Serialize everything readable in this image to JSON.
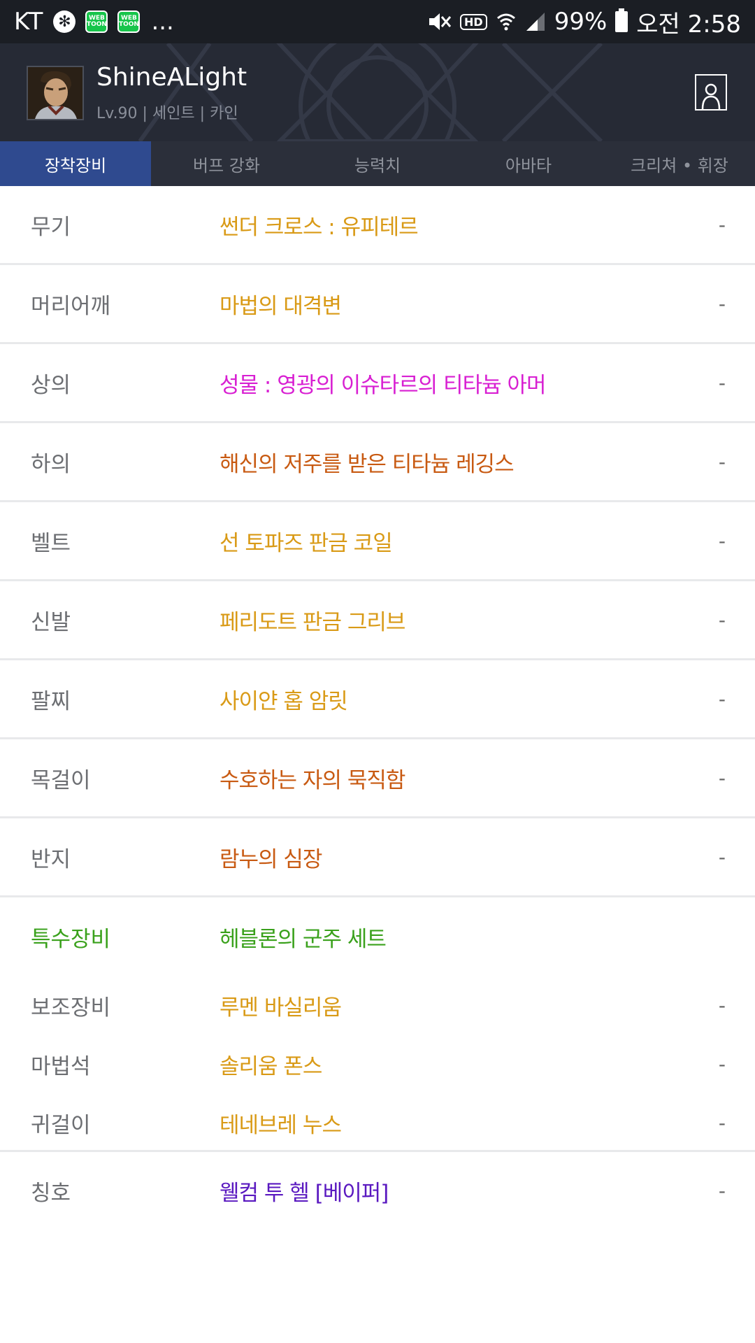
{
  "status_bar": {
    "carrier": "KT",
    "more": "...",
    "battery": "99%",
    "time": "오전 2:58",
    "hd": "HD",
    "webtoon_label": "WEB TOON",
    "icons": [
      "gear-icon",
      "webtoon-icon",
      "webtoon-icon",
      "mute-icon",
      "hd-icon",
      "wifi-icon",
      "signal-icon",
      "battery-icon"
    ]
  },
  "header": {
    "name": "ShineALight",
    "meta": "Lv.90 | 세인트 | 카인"
  },
  "tabs": [
    {
      "label": "장착장비",
      "active": true
    },
    {
      "label": "버프 강화",
      "active": false
    },
    {
      "label": "능력치",
      "active": false
    },
    {
      "label": "아바타",
      "active": false
    },
    {
      "label": "크리쳐 • 휘장",
      "active": false
    }
  ],
  "equipment": [
    {
      "slot": "무기",
      "item": "썬더 크로스 : 유피테르",
      "color": "#d99a16",
      "value": "-"
    },
    {
      "slot": "머리어깨",
      "item": "마법의 대격변",
      "color": "#d99a16",
      "value": "-"
    },
    {
      "slot": "상의",
      "item": "성물 : 영광의 이슈타르의 티타늄 아머",
      "color": "#d81fd2",
      "value": "-"
    },
    {
      "slot": "하의",
      "item": "해신의 저주를 받은 티타늄 레깅스",
      "color": "#c85a12",
      "value": "-"
    },
    {
      "slot": "벨트",
      "item": "선 토파즈 판금 코일",
      "color": "#d99a16",
      "value": "-"
    },
    {
      "slot": "신발",
      "item": "페리도트 판금 그리브",
      "color": "#d99a16",
      "value": "-"
    },
    {
      "slot": "팔찌",
      "item": "사이얀 홉 암릿",
      "color": "#d99a16",
      "value": "-"
    },
    {
      "slot": "목걸이",
      "item": "수호하는 자의 묵직함",
      "color": "#c85a12",
      "value": "-"
    },
    {
      "slot": "반지",
      "item": "람누의 심장",
      "color": "#c85a12",
      "value": "-"
    }
  ],
  "special": {
    "slot": "특수장비",
    "set": "헤블론의 군주 세트",
    "color": "#3aa11c",
    "items": [
      {
        "slot": "보조장비",
        "item": "루멘 바실리움",
        "color": "#d99a16",
        "value": "-"
      },
      {
        "slot": "마법석",
        "item": "솔리움 폰스",
        "color": "#d99a16",
        "value": "-"
      },
      {
        "slot": "귀걸이",
        "item": "테네브레 누스",
        "color": "#d99a16",
        "value": "-"
      }
    ]
  },
  "title_row": {
    "slot": "칭호",
    "item": "웰컴 투 헬 [베이퍼]",
    "color": "#5a19c0",
    "value": "-"
  }
}
